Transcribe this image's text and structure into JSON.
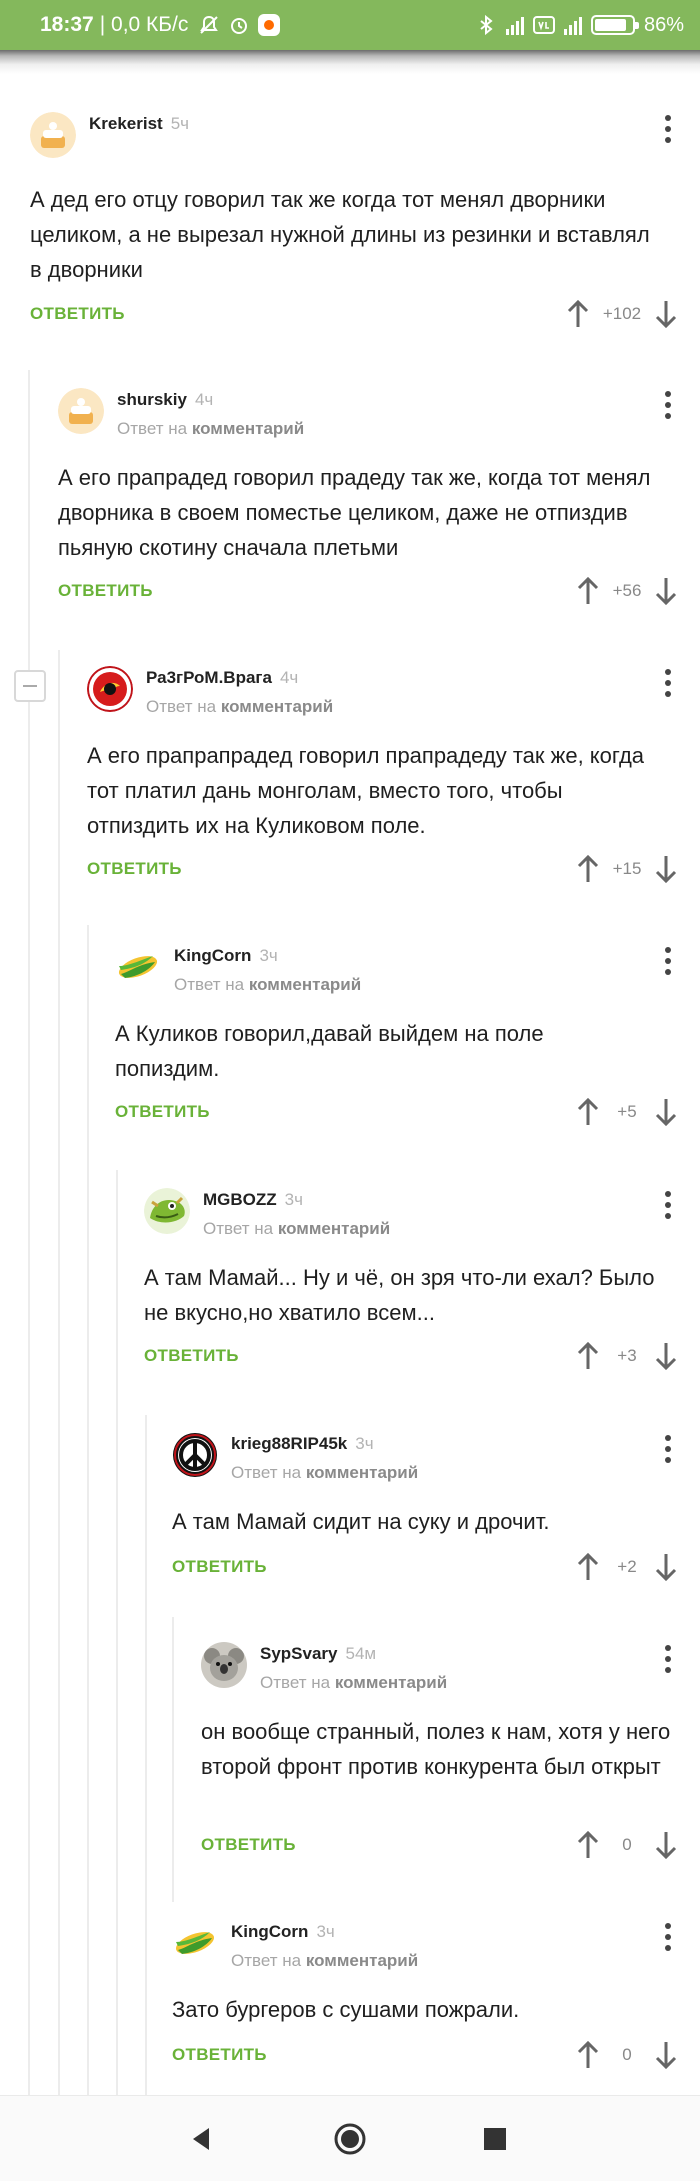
{
  "status_bar": {
    "time": "18:37",
    "network": "| 0,0 КБ/с",
    "battery": "86%",
    "battery_level": 0.86
  },
  "reply_to": {
    "prefix": "Ответ на",
    "target": "комментарий"
  },
  "reply_label": "ОТВЕТИТЬ",
  "comments": [
    {
      "author": "Krekerist",
      "time": "5ч",
      "text": "А дед его отцу говорил так же когда тот менял дворники целиком, а не вырезал нужной длины из резинки и вставлял в дворники",
      "score": "+102",
      "avatar": "cake-avatar"
    },
    {
      "author": "shurskiy",
      "time": "4ч",
      "text": "А его прапрадед говорил прадеду так же, когда тот менял дворника в своем поместье целиком, даже не отпиздив пьяную скотину сначала плетьми",
      "score": "+56",
      "avatar": "cake-avatar"
    },
    {
      "author": "Ра3гРоМ.Врага",
      "time": "4ч",
      "text": "А его прапрапрадед говорил прапрадеду так же, когда тот платил дань монголам, вместо того, чтобы отпиздить их на Куликовом поле.",
      "score": "+15",
      "avatar": "red-emblem-avatar"
    },
    {
      "author": "KingCorn",
      "time": "3ч",
      "text": "А Куликов говорил,давай выйдем на поле попиздим.",
      "score": "+5",
      "avatar": "corn-avatar"
    },
    {
      "author": "MGBOZZ",
      "time": "3ч",
      "text": "А там Мамай... Ну и чё, он зря что-ли ехал? Было не вкусно,но хватило всем...",
      "score": "+3",
      "avatar": "creature-avatar"
    },
    {
      "author": "krieg88RIP45k",
      "time": "3ч",
      "text": "А там Мамай сидит на суку и дрочит.",
      "score": "+2",
      "avatar": "peace-symbol-avatar"
    },
    {
      "author": "SypSvary",
      "time": "54м",
      "text": "он вообще странный, полез к нам, хотя у него второй фронт против конкурента был открыт",
      "score": "0",
      "avatar": "koala-avatar"
    },
    {
      "author": "KingCorn",
      "time": "3ч",
      "text": "Зато бургеров с сушами пожрали.",
      "score": "0",
      "avatar": "corn-avatar"
    }
  ],
  "colors": {
    "status_bar": "#84b85c",
    "reply_button": "#69b238",
    "thread_line": "#ececec"
  },
  "icons": {
    "upvote": "arrow-up-icon",
    "downvote": "arrow-down-icon",
    "menu": "more-vertical-icon",
    "collapse": "minus-square-icon",
    "nav_back": "triangle-back-icon",
    "nav_home": "circle-home-icon",
    "nav_recents": "square-recents-icon"
  }
}
